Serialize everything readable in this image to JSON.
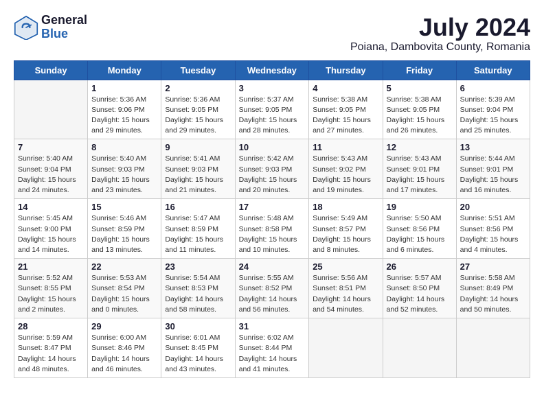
{
  "header": {
    "logo_general": "General",
    "logo_blue": "Blue",
    "month_year": "July 2024",
    "location": "Poiana, Dambovita County, Romania"
  },
  "days_of_week": [
    "Sunday",
    "Monday",
    "Tuesday",
    "Wednesday",
    "Thursday",
    "Friday",
    "Saturday"
  ],
  "weeks": [
    [
      {
        "day": "",
        "info": ""
      },
      {
        "day": "1",
        "info": "Sunrise: 5:36 AM\nSunset: 9:06 PM\nDaylight: 15 hours\nand 29 minutes."
      },
      {
        "day": "2",
        "info": "Sunrise: 5:36 AM\nSunset: 9:05 PM\nDaylight: 15 hours\nand 29 minutes."
      },
      {
        "day": "3",
        "info": "Sunrise: 5:37 AM\nSunset: 9:05 PM\nDaylight: 15 hours\nand 28 minutes."
      },
      {
        "day": "4",
        "info": "Sunrise: 5:38 AM\nSunset: 9:05 PM\nDaylight: 15 hours\nand 27 minutes."
      },
      {
        "day": "5",
        "info": "Sunrise: 5:38 AM\nSunset: 9:05 PM\nDaylight: 15 hours\nand 26 minutes."
      },
      {
        "day": "6",
        "info": "Sunrise: 5:39 AM\nSunset: 9:04 PM\nDaylight: 15 hours\nand 25 minutes."
      }
    ],
    [
      {
        "day": "7",
        "info": "Sunrise: 5:40 AM\nSunset: 9:04 PM\nDaylight: 15 hours\nand 24 minutes."
      },
      {
        "day": "8",
        "info": "Sunrise: 5:40 AM\nSunset: 9:03 PM\nDaylight: 15 hours\nand 23 minutes."
      },
      {
        "day": "9",
        "info": "Sunrise: 5:41 AM\nSunset: 9:03 PM\nDaylight: 15 hours\nand 21 minutes."
      },
      {
        "day": "10",
        "info": "Sunrise: 5:42 AM\nSunset: 9:03 PM\nDaylight: 15 hours\nand 20 minutes."
      },
      {
        "day": "11",
        "info": "Sunrise: 5:43 AM\nSunset: 9:02 PM\nDaylight: 15 hours\nand 19 minutes."
      },
      {
        "day": "12",
        "info": "Sunrise: 5:43 AM\nSunset: 9:01 PM\nDaylight: 15 hours\nand 17 minutes."
      },
      {
        "day": "13",
        "info": "Sunrise: 5:44 AM\nSunset: 9:01 PM\nDaylight: 15 hours\nand 16 minutes."
      }
    ],
    [
      {
        "day": "14",
        "info": "Sunrise: 5:45 AM\nSunset: 9:00 PM\nDaylight: 15 hours\nand 14 minutes."
      },
      {
        "day": "15",
        "info": "Sunrise: 5:46 AM\nSunset: 8:59 PM\nDaylight: 15 hours\nand 13 minutes."
      },
      {
        "day": "16",
        "info": "Sunrise: 5:47 AM\nSunset: 8:59 PM\nDaylight: 15 hours\nand 11 minutes."
      },
      {
        "day": "17",
        "info": "Sunrise: 5:48 AM\nSunset: 8:58 PM\nDaylight: 15 hours\nand 10 minutes."
      },
      {
        "day": "18",
        "info": "Sunrise: 5:49 AM\nSunset: 8:57 PM\nDaylight: 15 hours\nand 8 minutes."
      },
      {
        "day": "19",
        "info": "Sunrise: 5:50 AM\nSunset: 8:56 PM\nDaylight: 15 hours\nand 6 minutes."
      },
      {
        "day": "20",
        "info": "Sunrise: 5:51 AM\nSunset: 8:56 PM\nDaylight: 15 hours\nand 4 minutes."
      }
    ],
    [
      {
        "day": "21",
        "info": "Sunrise: 5:52 AM\nSunset: 8:55 PM\nDaylight: 15 hours\nand 2 minutes."
      },
      {
        "day": "22",
        "info": "Sunrise: 5:53 AM\nSunset: 8:54 PM\nDaylight: 15 hours\nand 0 minutes."
      },
      {
        "day": "23",
        "info": "Sunrise: 5:54 AM\nSunset: 8:53 PM\nDaylight: 14 hours\nand 58 minutes."
      },
      {
        "day": "24",
        "info": "Sunrise: 5:55 AM\nSunset: 8:52 PM\nDaylight: 14 hours\nand 56 minutes."
      },
      {
        "day": "25",
        "info": "Sunrise: 5:56 AM\nSunset: 8:51 PM\nDaylight: 14 hours\nand 54 minutes."
      },
      {
        "day": "26",
        "info": "Sunrise: 5:57 AM\nSunset: 8:50 PM\nDaylight: 14 hours\nand 52 minutes."
      },
      {
        "day": "27",
        "info": "Sunrise: 5:58 AM\nSunset: 8:49 PM\nDaylight: 14 hours\nand 50 minutes."
      }
    ],
    [
      {
        "day": "28",
        "info": "Sunrise: 5:59 AM\nSunset: 8:47 PM\nDaylight: 14 hours\nand 48 minutes."
      },
      {
        "day": "29",
        "info": "Sunrise: 6:00 AM\nSunset: 8:46 PM\nDaylight: 14 hours\nand 46 minutes."
      },
      {
        "day": "30",
        "info": "Sunrise: 6:01 AM\nSunset: 8:45 PM\nDaylight: 14 hours\nand 43 minutes."
      },
      {
        "day": "31",
        "info": "Sunrise: 6:02 AM\nSunset: 8:44 PM\nDaylight: 14 hours\nand 41 minutes."
      },
      {
        "day": "",
        "info": ""
      },
      {
        "day": "",
        "info": ""
      },
      {
        "day": "",
        "info": ""
      }
    ]
  ]
}
